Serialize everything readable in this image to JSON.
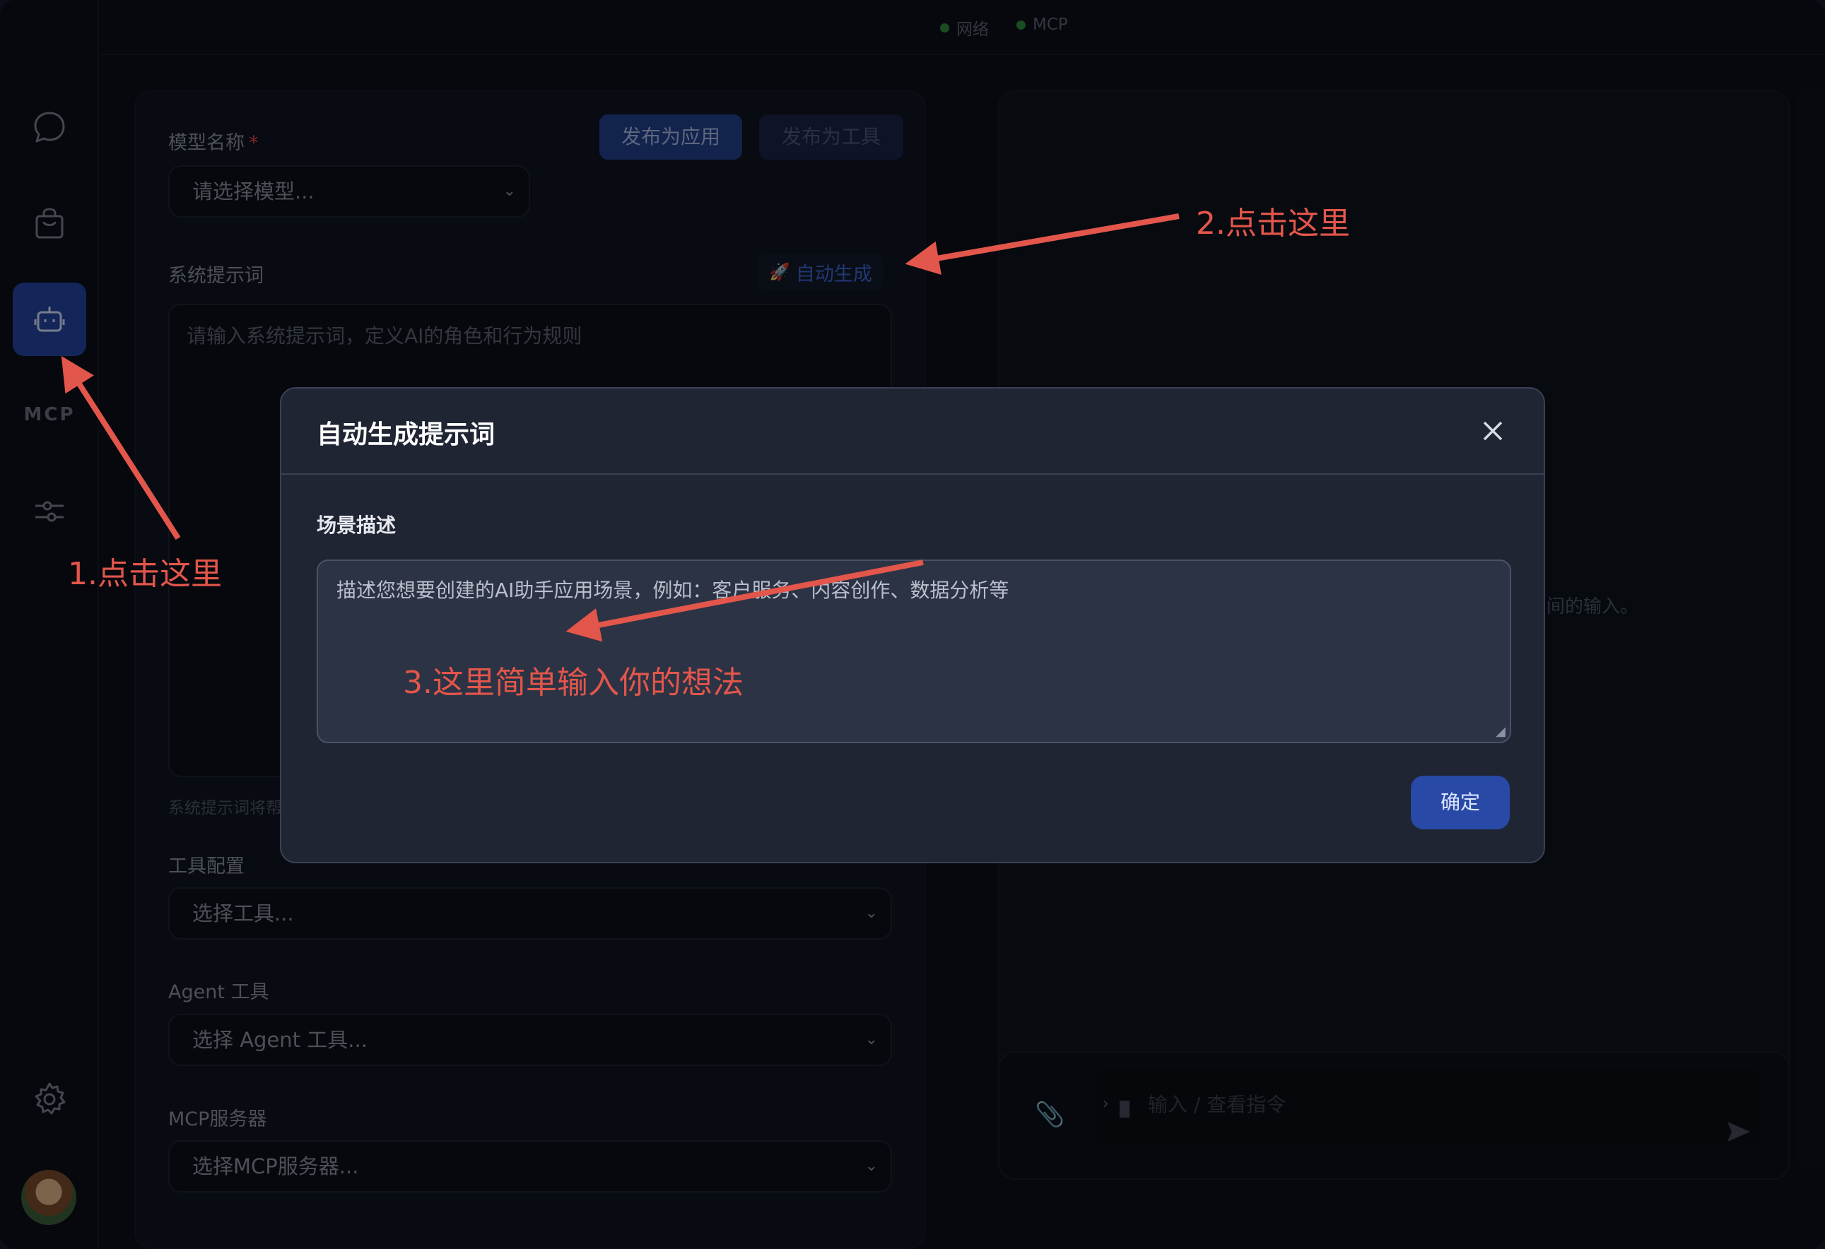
{
  "titlebar": {
    "status_network": "网络",
    "status_mcp": "MCP"
  },
  "sidebar": {
    "items": [
      {
        "name": "chat",
        "icon": "chat-bubble-icon"
      },
      {
        "name": "store",
        "icon": "shopping-bag-icon"
      },
      {
        "name": "agent",
        "icon": "robot-icon",
        "active": true
      },
      {
        "name": "mcp",
        "label": "MCP"
      },
      {
        "name": "settings-tools",
        "icon": "sliders-icon"
      },
      {
        "name": "settings",
        "icon": "gear-icon"
      }
    ],
    "mcp_label": "MCP"
  },
  "config": {
    "model_label": "模型名称",
    "required_mark": "*",
    "model_placeholder": "请选择模型...",
    "publish_app": "发布为应用",
    "publish_tool": "发布为工具",
    "system_prompt_label": "系统提示词",
    "auto_generate": "自动生成",
    "system_prompt_placeholder": "请输入系统提示词，定义AI的角色和行为规则",
    "system_prompt_hint": "系统提示词将帮",
    "tools_label": "工具配置",
    "tools_placeholder": "选择工具...",
    "agent_tools_label": "Agent 工具",
    "agent_tools_placeholder": "选择 Agent 工具...",
    "mcp_servers_label": "MCP服务器",
    "mcp_servers_placeholder": "选择MCP服务器..."
  },
  "chat": {
    "partial_text": "间的输入。",
    "input_placeholder": "输入 / 查看指令"
  },
  "modal": {
    "title": "自动生成提示词",
    "field_label": "场景描述",
    "textarea_placeholder": "描述您想要创建的AI助手应用场景，例如：客户服务、内容创作、数据分析等",
    "confirm": "确定"
  },
  "annotations": {
    "step1": "1.点击这里",
    "step2": "2.点击这里",
    "step3": "3.这里简单输入你的想法",
    "color": "#e3564b"
  },
  "colors": {
    "accent": "#2546a3",
    "status_dot": "#2f8a3c",
    "required": "#e5484d"
  }
}
